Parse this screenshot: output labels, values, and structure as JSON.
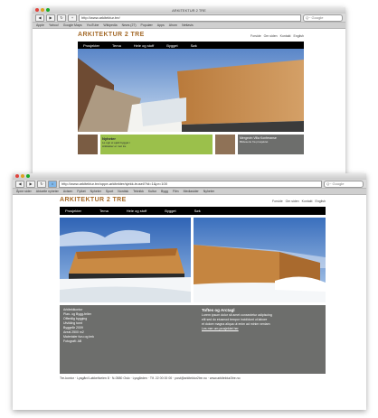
{
  "colors": {
    "brand": "#a56b2b",
    "nav": "#000000",
    "green": "#9bc04b",
    "grey": "#6d6e6c"
  },
  "window1": {
    "title": "ARKITEKTUR 2 TRE",
    "url": "http://www.arkitektur.tre/",
    "search_placeholder": "Q~ Google",
    "bookmarks": [
      "Apple",
      "Yahoo!",
      "Google Maps",
      "YouTube",
      "Wikipedia",
      "News (27)",
      "Populær",
      "Apps",
      "Ahorn",
      "Nettavis"
    ],
    "site": {
      "logo": "ARKITEKTUR 2 TRE",
      "toplinks": [
        "Forside",
        "Om siden",
        "Kontakt",
        "English"
      ],
      "nav": [
        "Prosjekter",
        "Tema",
        "Hele og stoff",
        "Bygget",
        "Søk"
      ],
      "panel_green": {
        "title": "Nyheter",
        "lines": [
          "Le ogn ei ejekt bygget i",
          "Arkitekter er mot tre",
          "Lorem ipsum dolor"
        ]
      },
      "panel_grey": {
        "title": "Mergevin Villa Konferanse",
        "lines": [
          "Bildeserie fra prosjektet"
        ]
      }
    }
  },
  "window2": {
    "title": "",
    "url": "http://www.arkitektur.tre/oppe-arkitekter/sjekk-trusel/?id=1&pr=100",
    "search_placeholder": "Q~ Google",
    "bookmarks": [
      "Åpne sider",
      "Aktuelle nyheter",
      "Avisen",
      "Fylket",
      "Nyheter",
      "Sport",
      "Nordisk",
      "Teknikk",
      "Kultur",
      "Bygg",
      "Film",
      "Mediasider",
      "Nyheter"
    ],
    "site": {
      "logo": "ARKITEKTUR 2 TRE",
      "toplinks": [
        "Forside",
        "Om siden",
        "Kontakt",
        "English"
      ],
      "nav": [
        "Prosjekter",
        "Tema",
        "Hele og stoff",
        "Bygget",
        "Søk"
      ],
      "info_left": [
        "Arkitektkontor",
        "Plan- og Bygg-felter",
        "Offentlig bygging",
        "Utvikling tomt",
        "Byggeår 2009",
        "Areal 2500 m2",
        "Materialer furu og lerk",
        "Fotografi: AB"
      ],
      "info_right": {
        "title": "Toftes og Arctagl",
        "lines": [
          "Lorem ipsum dolor sit amet consectetur adipiscing",
          "elit sed do eiusmod tempor incididunt ut labore",
          "et dolore magna aliqua ut enim ad minim veniam",
          "",
          "Les mer om prosjektet her"
        ]
      },
      "footer": "Tre-kontor · Lysgård Løkkeliveien 8 · N-0580 Oslo · Lysgården · Tlf. 22 00 00 00 · post@arkitektur2tre.no · www.arkitektur2tre.no"
    }
  }
}
